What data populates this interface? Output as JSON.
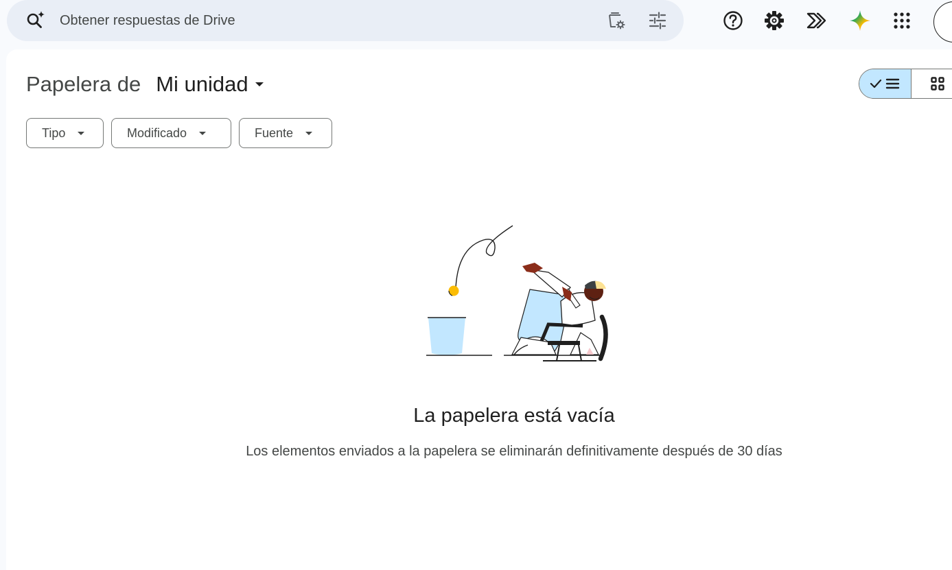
{
  "search": {
    "placeholder": "Obtener respuestas de Drive"
  },
  "header": {
    "icons": [
      "help-icon",
      "settings-icon",
      "ai-tools-icon",
      "gemini-icon",
      "apps-grid-icon",
      "account-avatar"
    ]
  },
  "page": {
    "title_prefix": "Papelera de",
    "location": "Mi unidad"
  },
  "view_toggle": {
    "active": "list",
    "options": [
      "list",
      "grid"
    ]
  },
  "filters": [
    {
      "label": "Tipo"
    },
    {
      "label": "Modificado"
    },
    {
      "label": "Fuente"
    }
  ],
  "empty_state": {
    "title": "La papelera está vacía",
    "subtitle": "Los elementos enviados a la papelera se eliminarán definitivamente después de 30 días"
  },
  "colors": {
    "search_bg": "#e9eef6",
    "toggle_active": "#c2e7ff",
    "page_bg": "#f8fafd",
    "panel_bg": "#ffffff"
  }
}
